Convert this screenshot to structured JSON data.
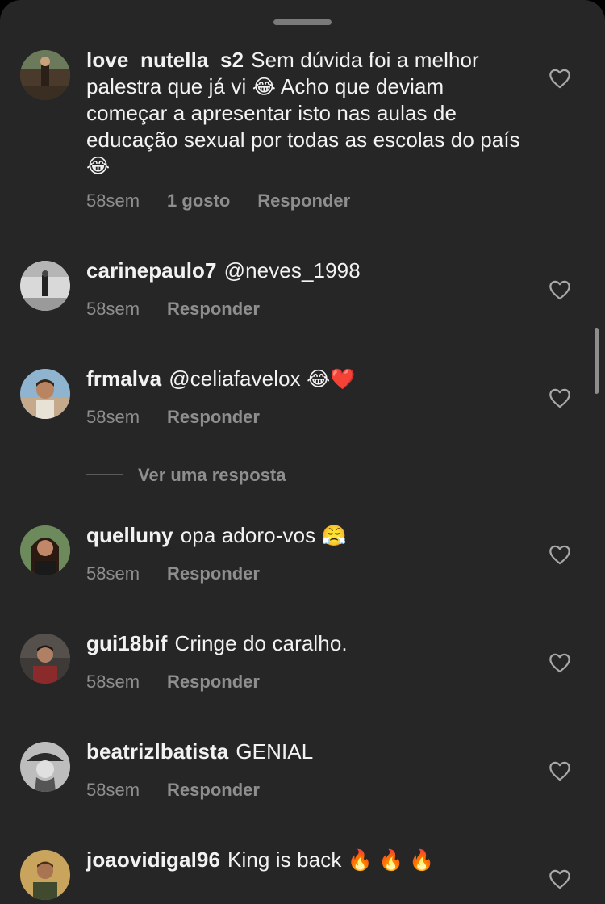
{
  "comments": [
    {
      "username": "love_nutella_s2",
      "text_parts": [
        "Sem dúvida foi a melhor palestra que já vi ",
        "😂",
        " Acho que deviam começar a apresentar isto nas aulas de educação sexual por todas as escolas do país ",
        "😂"
      ],
      "time": "58sem",
      "likes": "1 gosto",
      "reply": "Responder"
    },
    {
      "username": "carinepaulo7",
      "text": "@neves_1998",
      "time": "58sem",
      "reply": "Responder"
    },
    {
      "username": "frmalva",
      "text": "@celiafavelox",
      "emojis": "😂❤️",
      "time": "58sem",
      "reply": "Responder",
      "view_replies": "Ver uma resposta"
    },
    {
      "username": "quelluny",
      "text": "opa adoro-vos",
      "emojis": "😤",
      "time": "58sem",
      "reply": "Responder"
    },
    {
      "username": "gui18bif",
      "text": "Cringe do caralho.",
      "time": "58sem",
      "reply": "Responder"
    },
    {
      "username": "beatrizlbatista",
      "text": "GENIAL",
      "time": "58sem",
      "reply": "Responder"
    },
    {
      "username": "joaovidigal96",
      "text": "King is back",
      "emojis": "🔥 🔥 🔥"
    }
  ],
  "colors": {
    "sheet_background": "#262626",
    "primary_text": "#f2f2f2",
    "secondary_text": "#8e8e8e"
  },
  "icons": {
    "like": "heart-outline-icon"
  }
}
